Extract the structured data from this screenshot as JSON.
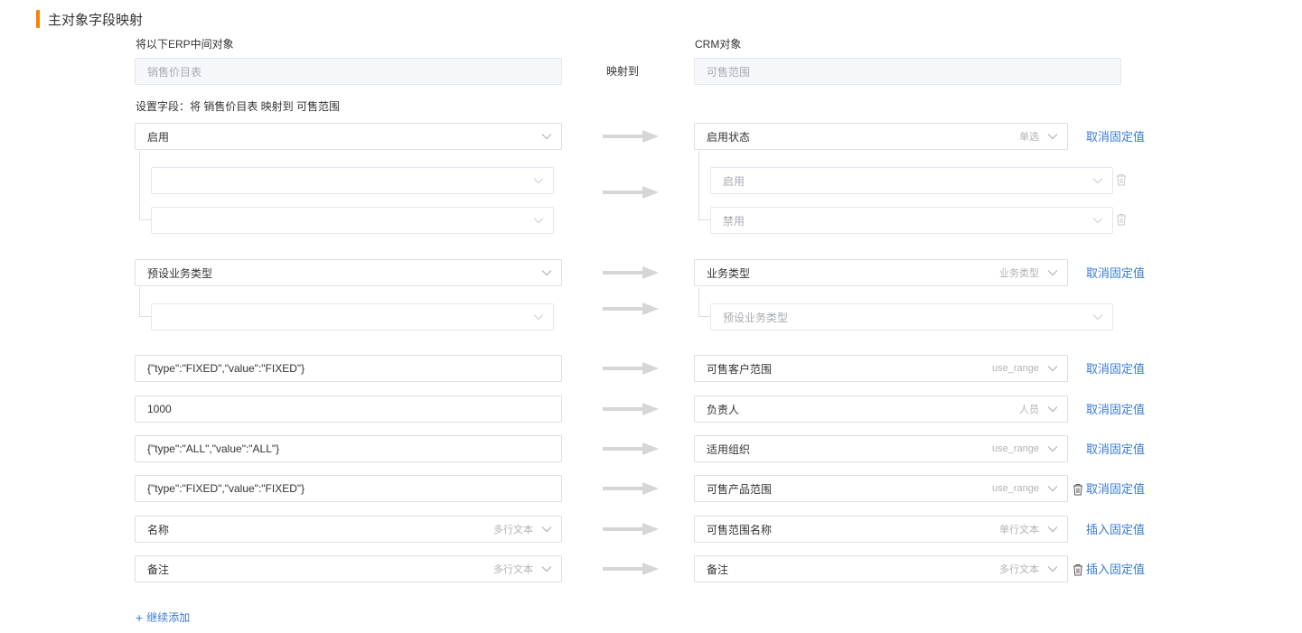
{
  "section_title": "主对象字段映射",
  "source": {
    "label": "将以下ERP中间对象",
    "value": "销售价目表"
  },
  "map_to_label": "映射到",
  "target": {
    "label": "CRM对象",
    "value": "可售范围"
  },
  "settings_caption": "设置字段：将 销售价目表 映射到 可售范围",
  "rows": [
    {
      "left": "启用",
      "right": "启用状态",
      "right_hint": "单选",
      "action": "取消固定值"
    },
    {
      "left": "预设业务类型",
      "right": "业务类型",
      "right_hint": "业务类型",
      "action": "取消固定值"
    },
    {
      "left": "{\"type\":\"FIXED\",\"value\":\"FIXED\"}",
      "right": "可售客户范围",
      "right_hint": "use_range",
      "action": "取消固定值"
    },
    {
      "left": "1000",
      "right": "负责人",
      "right_hint": "人员",
      "action": "取消固定值"
    },
    {
      "left": "{\"type\":\"ALL\",\"value\":\"ALL\"}",
      "right": "适用组织",
      "right_hint": "use_range",
      "action": "取消固定值"
    },
    {
      "left": "{\"type\":\"FIXED\",\"value\":\"FIXED\"}",
      "right": "可售产品范围",
      "right_hint": "use_range",
      "action": "取消固定值"
    },
    {
      "left": "名称",
      "left_hint": "多行文本",
      "right": "可售范围名称",
      "right_hint": "单行文本",
      "action": "插入固定值"
    },
    {
      "left": "备注",
      "left_hint": "多行文本",
      "right": "备注",
      "right_hint": "多行文本",
      "action": "插入固定值"
    }
  ],
  "sub_options": {
    "enable_1": "启用",
    "enable_2": "禁用",
    "biz_type_1": "预设业务类型"
  },
  "add_more_label": "继续添加",
  "colors": {
    "accent": "#ff8000",
    "link": "#3a7bd5",
    "border": "#dcdfe6",
    "arrow": "#d6d6d6"
  }
}
